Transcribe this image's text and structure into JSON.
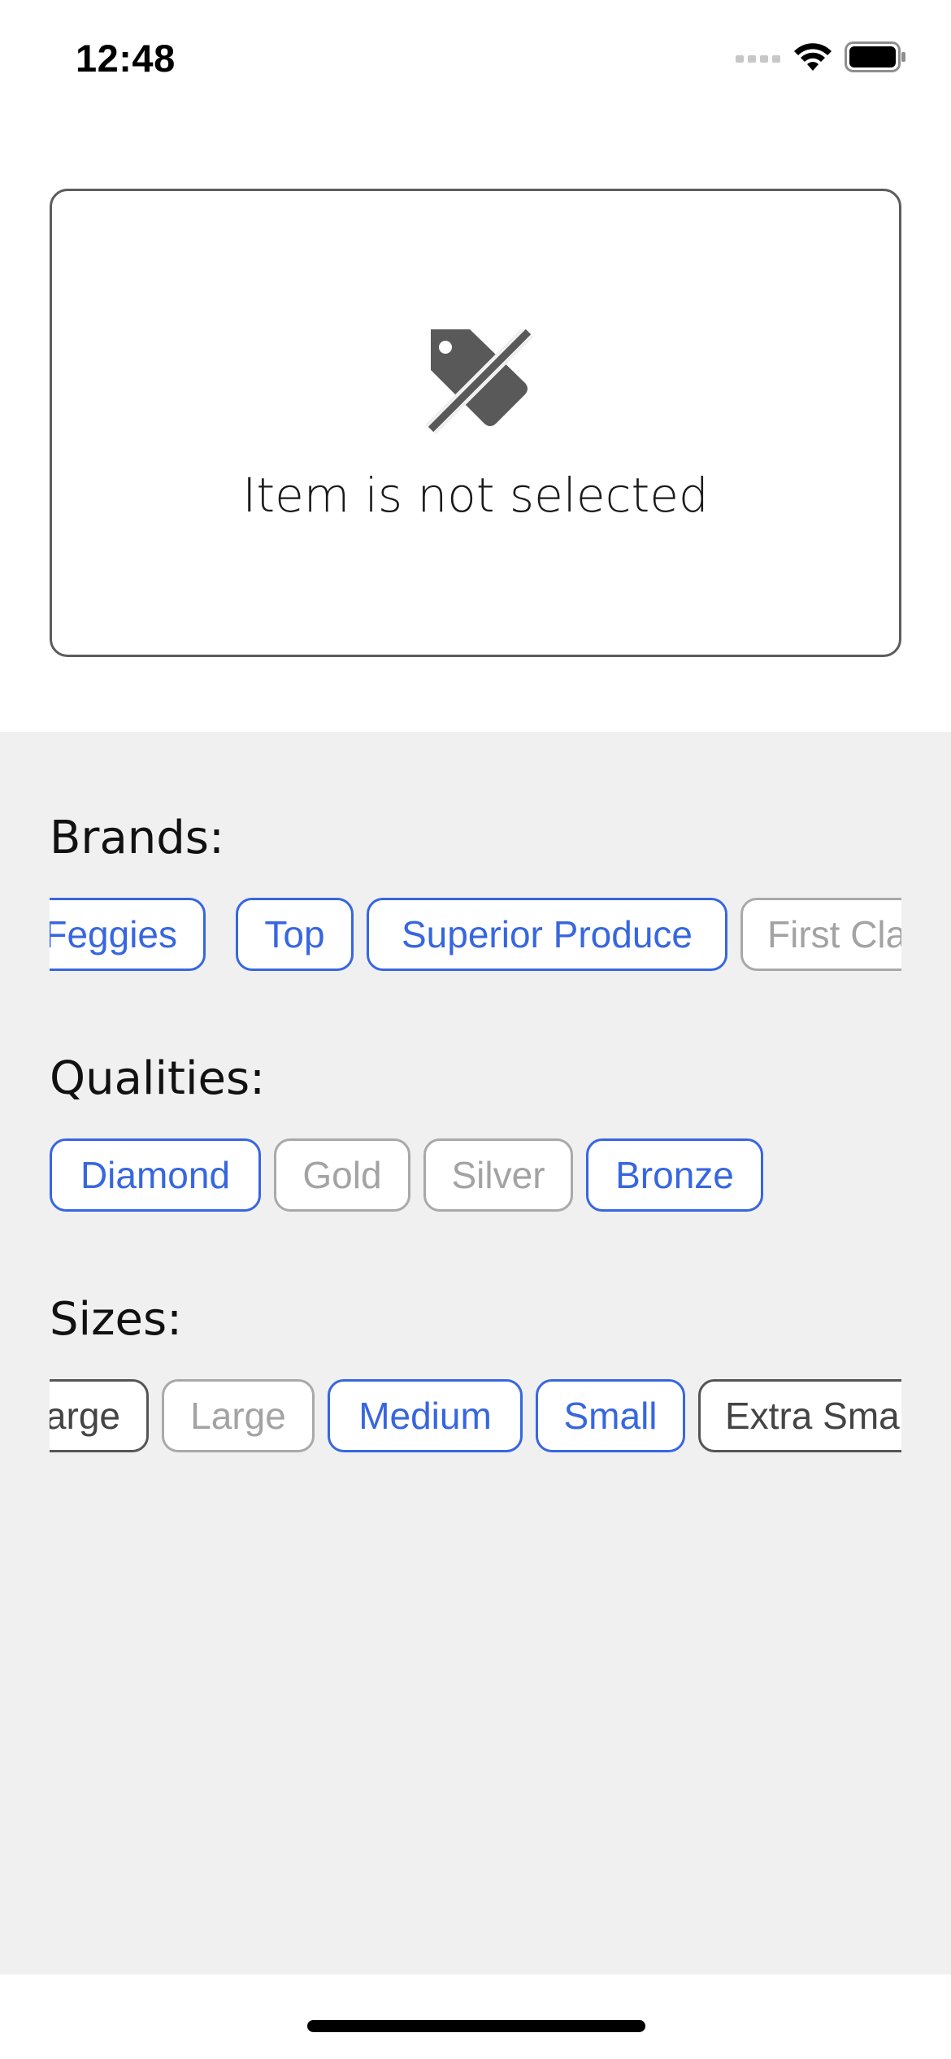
{
  "status_bar": {
    "time": "12:48",
    "icons": [
      "signal-icon",
      "wifi-icon",
      "battery-icon"
    ]
  },
  "placeholder": {
    "icon": "tag-slash-icon",
    "message": "Item is not selected"
  },
  "brands": {
    "title": "Brands:",
    "chips": [
      {
        "label": "Feggies",
        "state": "selected"
      },
      {
        "label": "Top",
        "state": "selected"
      },
      {
        "label": "Superior Produce",
        "state": "selected"
      },
      {
        "label": "First Cla",
        "state": "unselected"
      }
    ]
  },
  "qualities": {
    "title": "Qualities:",
    "chips": [
      {
        "label": "Diamond",
        "state": "selected"
      },
      {
        "label": "Gold",
        "state": "unselected"
      },
      {
        "label": "Silver",
        "state": "unselected"
      },
      {
        "label": "Bronze",
        "state": "selected"
      }
    ]
  },
  "sizes": {
    "title": "Sizes:",
    "chips": [
      {
        "label": "arge",
        "state": "neutral"
      },
      {
        "label": "Large",
        "state": "unselected"
      },
      {
        "label": "Medium",
        "state": "selected"
      },
      {
        "label": "Small",
        "state": "selected"
      },
      {
        "label": "Extra Sma",
        "state": "neutral"
      }
    ]
  },
  "colors": {
    "accent": "#3766e0",
    "unselected": "#a9a9a9",
    "neutral": "#555555",
    "panel_background": "#f0f0f0"
  }
}
